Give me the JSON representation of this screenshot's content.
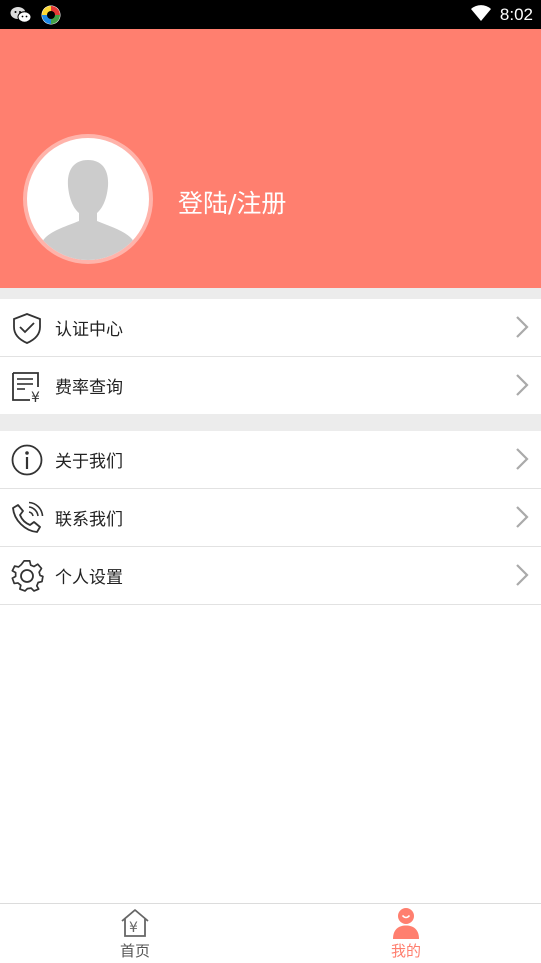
{
  "status_bar": {
    "time": "8:02",
    "left_icons": [
      "wechat-icon",
      "app-icon"
    ],
    "right_icons": [
      "wifi-icon"
    ]
  },
  "header": {
    "background": "#ff7f6f",
    "avatar_icon": "default-avatar-icon",
    "login_label": "登陆/注册"
  },
  "menu_group_1": [
    {
      "label": "认证中心",
      "icon": "shield-check-icon"
    },
    {
      "label": "费率查询",
      "icon": "rate-receipt-icon"
    }
  ],
  "menu_group_2": [
    {
      "label": "关于我们",
      "icon": "info-icon"
    },
    {
      "label": "联系我们",
      "icon": "phone-icon"
    },
    {
      "label": "个人设置",
      "icon": "gear-icon"
    }
  ],
  "tab_bar": {
    "tabs": [
      {
        "label": "首页",
        "icon": "home-yuan-icon",
        "active": false
      },
      {
        "label": "我的",
        "icon": "profile-icon",
        "active": true
      }
    ],
    "active_color": "#ff7f6f",
    "inactive_color": "#555555"
  }
}
